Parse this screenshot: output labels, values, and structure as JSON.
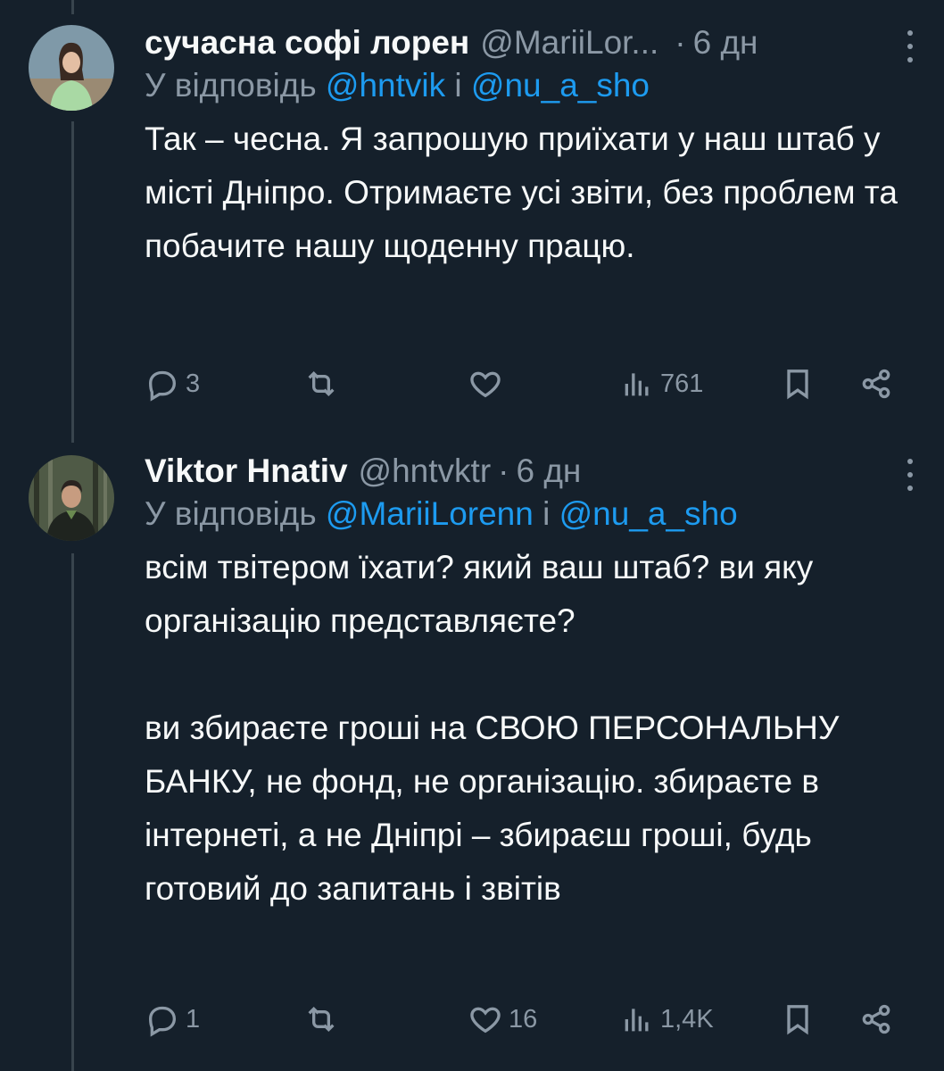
{
  "tweets": [
    {
      "name": "сучасна софі лорен",
      "handle": "@MariiLor...",
      "time": "6 дн",
      "reply_prefix": "У відповідь",
      "reply_mention_1": "@hntvik",
      "reply_joiner": "і",
      "reply_mention_2": "@nu_a_sho",
      "text": [
        "Так – чесна. Я запрошую приїхати у наш штаб у місті Дніпро. Отримаєте усі звіти, без проблем та побачите нашу щоденну працю."
      ],
      "stats": {
        "replies": "3",
        "retweets": "",
        "likes": "",
        "views": "761"
      }
    },
    {
      "name": "Viktor Hnativ",
      "handle": "@hntvktr",
      "time": "6 дн",
      "reply_prefix": "У відповідь",
      "reply_mention_1": "@MariiLorenn",
      "reply_joiner": "і",
      "reply_mention_2": "@nu_a_sho",
      "text": [
        "всім твітером їхати? який ваш штаб? ви яку організацію представляєте?",
        "ви збираєте гроші на СВОЮ ПЕРСОНАЛЬНУ БАНКУ, не фонд, не організацію. збираєте в інтернеті, а не Дніпрі – збираєш гроші, будь готовий до запитань і звітів"
      ],
      "stats": {
        "replies": "1",
        "retweets": "",
        "likes": "16",
        "views": "1,4K"
      }
    }
  ],
  "icons": {
    "reply": "reply-icon",
    "retweet": "retweet-icon",
    "like": "heart-icon",
    "views": "views-icon",
    "bookmark": "bookmark-icon",
    "share": "share-icon",
    "more": "more-dots-icon"
  },
  "colors": {
    "background": "#15202b",
    "text": "#f7f9f9",
    "secondary": "#8b98a5",
    "mention": "#1d9bf0"
  }
}
